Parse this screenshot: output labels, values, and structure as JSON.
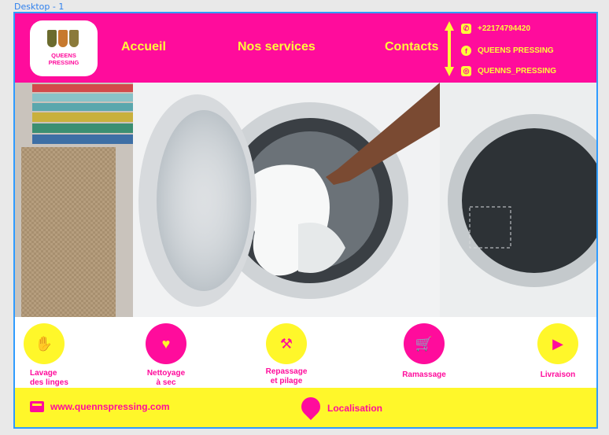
{
  "canvas_label": "Desktop - 1",
  "header": {
    "logo": {
      "brand_line1": "QUEENS",
      "brand_line2": "PRESSING"
    },
    "nav": {
      "accueil": "Accueil",
      "services": "Nos services",
      "contacts": "Contacts"
    },
    "contacts": {
      "phone": "+22174794420",
      "facebook": "QUEENS PRESSING",
      "instagram": "QUENNS_PRESSING"
    }
  },
  "services": {
    "lavage": "Lavage\ndes linges",
    "nettoyage": "Nettoyage\nà sec",
    "repassage": "Repassage\net pilage",
    "ramassage": "Ramassage",
    "livraison": "Livraison"
  },
  "footer": {
    "website": "www.quennspressing.com",
    "location": "Localisation"
  },
  "colors": {
    "brand_pink": "#ff0c9c",
    "brand_yellow": "#fff72a",
    "frame_blue": "#2f9bff"
  },
  "icons": {
    "phone": "phone-icon",
    "facebook": "facebook-icon",
    "instagram": "instagram-icon",
    "lavage": "hand-wash-icon",
    "nettoyage": "hand-heart-icon",
    "repassage": "iron-icon",
    "ramassage": "cart-icon",
    "livraison": "truck-icon",
    "website": "web-icon",
    "location": "map-pin-icon"
  }
}
